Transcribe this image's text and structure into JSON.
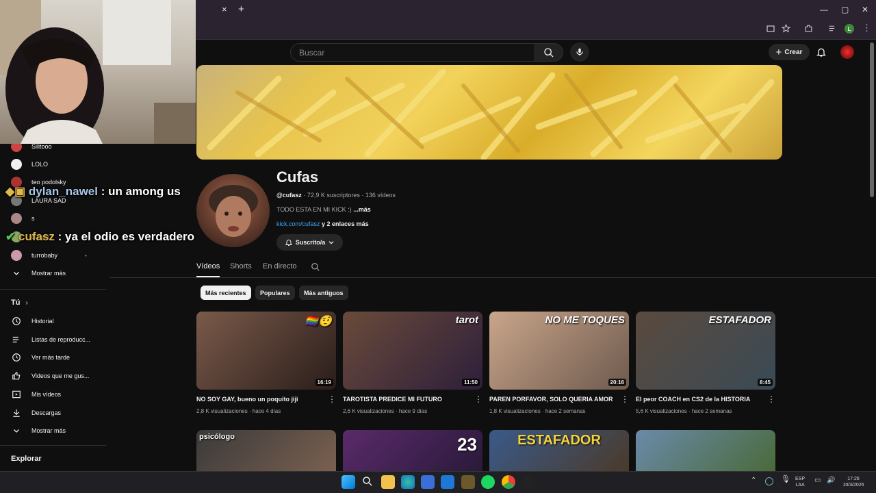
{
  "browser": {
    "tab_close": "×",
    "new_tab": "+",
    "window_controls": [
      "—",
      "▢",
      "✕"
    ],
    "profile_initial": "L"
  },
  "header": {
    "search_placeholder": "Buscar",
    "create_label": "Crear"
  },
  "channel": {
    "name": "Cufas",
    "handle": "@cufasz",
    "stats": "· 72,9 K suscriptores · 136 vídeos",
    "description": "TODO ESTA EN MI KICK :)",
    "more": "...más",
    "link": "kick.com/cufasz",
    "links_more": "y 2 enlaces más",
    "subscribe_label": "Suscrito/a"
  },
  "tabs": [
    {
      "label": "Vídeos",
      "active": true
    },
    {
      "label": "Shorts",
      "active": false
    },
    {
      "label": "En directo",
      "active": false
    }
  ],
  "chips": [
    {
      "label": "Más recientes",
      "active": true
    },
    {
      "label": "Populares",
      "active": false
    },
    {
      "label": "Más antiguos",
      "active": false
    }
  ],
  "videos": [
    {
      "title": "NO SOY GAY, bueno un poquito jiji",
      "views": "2,8 K visualizaciones",
      "age": "hace 4 días",
      "duration": "16:19",
      "overlay": "🏳️‍🌈🤨",
      "colors": [
        "#7a5a4a",
        "#2a1d1a"
      ]
    },
    {
      "title": "TAROTISTA PREDICE MI FUTURO",
      "views": "2,6 K visualizaciones",
      "age": "hace 9 días",
      "duration": "11:50",
      "overlay": "tarot",
      "colors": [
        "#6a4a3a",
        "#2d1f3a"
      ]
    },
    {
      "title": "PAREN PORFAVOR, SOLO QUERIA AMOR",
      "views": "1,8 K visualizaciones",
      "age": "hace 2 semanas",
      "duration": "20:16",
      "overlay": "NO ME TOQUES",
      "colors": [
        "#c9a58a",
        "#6e5a4e"
      ]
    },
    {
      "title": "El peor COACH en CS2 de la HISTORIA",
      "views": "5,6 K visualizaciones",
      "age": "hace 2 semanas",
      "duration": "8:45",
      "overlay": "ESTAFADOR",
      "colors": [
        "#5a4a3e",
        "#3a4a55"
      ]
    }
  ],
  "videos_row2": [
    {
      "overlay": "psicólogo",
      "colors": [
        "#3a3a3a",
        "#7a6050"
      ]
    },
    {
      "overlay": "23",
      "colors": [
        "#5a2a6a",
        "#2a1a3a"
      ]
    },
    {
      "overlay": "ESTAFADOR",
      "colors": [
        "#3a5a8a",
        "#4a3a2a"
      ]
    },
    {
      "overlay": "",
      "colors": [
        "#6a8aaa",
        "#4a6a3a"
      ]
    }
  ],
  "sidebar": {
    "subs": [
      {
        "label": "Silitooo",
        "color": "#c44"
      },
      {
        "label": "LOLO",
        "color": "#f1f1f1"
      },
      {
        "label": "teo podolsky",
        "color": "#a33"
      },
      {
        "label": "LAURA SAD",
        "color": "#777"
      },
      {
        "label": "s",
        "color": "#a88"
      },
      {
        "label": "cufasz",
        "color": "#8a6"
      },
      {
        "label": "turrobaby",
        "color": "#c9a"
      }
    ],
    "show_more_1": "Mostrar más",
    "you_heading": "Tú",
    "you_items": [
      {
        "label": "Historial",
        "icon": "history-icon"
      },
      {
        "label": "Listas de reproducc...",
        "icon": "playlist-icon"
      },
      {
        "label": "Ver más tarde",
        "icon": "clock-icon"
      },
      {
        "label": "Videos que me gus...",
        "icon": "thumbs-up-icon"
      },
      {
        "label": "Mis vídeos",
        "icon": "my-videos-icon"
      },
      {
        "label": "Descargas",
        "icon": "download-icon"
      }
    ],
    "show_more_2": "Mostrar más",
    "explore_heading": "Explorar"
  },
  "chat_overlay": [
    {
      "user": "dylan_nawel",
      "text": ": un among us"
    },
    {
      "user": "cufasz",
      "text": ": ya el odio es verdadero"
    }
  ],
  "taskbar": {
    "lang_1": "ESP",
    "lang_2": "LAA",
    "time": "17:26",
    "date": "10/3/2026"
  }
}
